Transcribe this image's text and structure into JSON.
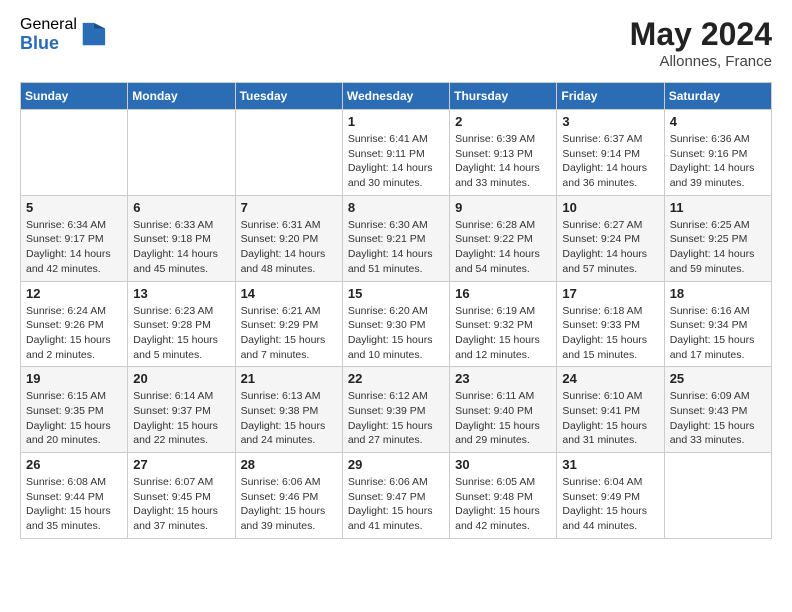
{
  "header": {
    "logo_general": "General",
    "logo_blue": "Blue",
    "month_year": "May 2024",
    "location": "Allonnes, France"
  },
  "days_of_week": [
    "Sunday",
    "Monday",
    "Tuesday",
    "Wednesday",
    "Thursday",
    "Friday",
    "Saturday"
  ],
  "weeks": [
    [
      {
        "day": "",
        "info": ""
      },
      {
        "day": "",
        "info": ""
      },
      {
        "day": "",
        "info": ""
      },
      {
        "day": "1",
        "info": "Sunrise: 6:41 AM\nSunset: 9:11 PM\nDaylight: 14 hours and 30 minutes."
      },
      {
        "day": "2",
        "info": "Sunrise: 6:39 AM\nSunset: 9:13 PM\nDaylight: 14 hours and 33 minutes."
      },
      {
        "day": "3",
        "info": "Sunrise: 6:37 AM\nSunset: 9:14 PM\nDaylight: 14 hours and 36 minutes."
      },
      {
        "day": "4",
        "info": "Sunrise: 6:36 AM\nSunset: 9:16 PM\nDaylight: 14 hours and 39 minutes."
      }
    ],
    [
      {
        "day": "5",
        "info": "Sunrise: 6:34 AM\nSunset: 9:17 PM\nDaylight: 14 hours and 42 minutes."
      },
      {
        "day": "6",
        "info": "Sunrise: 6:33 AM\nSunset: 9:18 PM\nDaylight: 14 hours and 45 minutes."
      },
      {
        "day": "7",
        "info": "Sunrise: 6:31 AM\nSunset: 9:20 PM\nDaylight: 14 hours and 48 minutes."
      },
      {
        "day": "8",
        "info": "Sunrise: 6:30 AM\nSunset: 9:21 PM\nDaylight: 14 hours and 51 minutes."
      },
      {
        "day": "9",
        "info": "Sunrise: 6:28 AM\nSunset: 9:22 PM\nDaylight: 14 hours and 54 minutes."
      },
      {
        "day": "10",
        "info": "Sunrise: 6:27 AM\nSunset: 9:24 PM\nDaylight: 14 hours and 57 minutes."
      },
      {
        "day": "11",
        "info": "Sunrise: 6:25 AM\nSunset: 9:25 PM\nDaylight: 14 hours and 59 minutes."
      }
    ],
    [
      {
        "day": "12",
        "info": "Sunrise: 6:24 AM\nSunset: 9:26 PM\nDaylight: 15 hours and 2 minutes."
      },
      {
        "day": "13",
        "info": "Sunrise: 6:23 AM\nSunset: 9:28 PM\nDaylight: 15 hours and 5 minutes."
      },
      {
        "day": "14",
        "info": "Sunrise: 6:21 AM\nSunset: 9:29 PM\nDaylight: 15 hours and 7 minutes."
      },
      {
        "day": "15",
        "info": "Sunrise: 6:20 AM\nSunset: 9:30 PM\nDaylight: 15 hours and 10 minutes."
      },
      {
        "day": "16",
        "info": "Sunrise: 6:19 AM\nSunset: 9:32 PM\nDaylight: 15 hours and 12 minutes."
      },
      {
        "day": "17",
        "info": "Sunrise: 6:18 AM\nSunset: 9:33 PM\nDaylight: 15 hours and 15 minutes."
      },
      {
        "day": "18",
        "info": "Sunrise: 6:16 AM\nSunset: 9:34 PM\nDaylight: 15 hours and 17 minutes."
      }
    ],
    [
      {
        "day": "19",
        "info": "Sunrise: 6:15 AM\nSunset: 9:35 PM\nDaylight: 15 hours and 20 minutes."
      },
      {
        "day": "20",
        "info": "Sunrise: 6:14 AM\nSunset: 9:37 PM\nDaylight: 15 hours and 22 minutes."
      },
      {
        "day": "21",
        "info": "Sunrise: 6:13 AM\nSunset: 9:38 PM\nDaylight: 15 hours and 24 minutes."
      },
      {
        "day": "22",
        "info": "Sunrise: 6:12 AM\nSunset: 9:39 PM\nDaylight: 15 hours and 27 minutes."
      },
      {
        "day": "23",
        "info": "Sunrise: 6:11 AM\nSunset: 9:40 PM\nDaylight: 15 hours and 29 minutes."
      },
      {
        "day": "24",
        "info": "Sunrise: 6:10 AM\nSunset: 9:41 PM\nDaylight: 15 hours and 31 minutes."
      },
      {
        "day": "25",
        "info": "Sunrise: 6:09 AM\nSunset: 9:43 PM\nDaylight: 15 hours and 33 minutes."
      }
    ],
    [
      {
        "day": "26",
        "info": "Sunrise: 6:08 AM\nSunset: 9:44 PM\nDaylight: 15 hours and 35 minutes."
      },
      {
        "day": "27",
        "info": "Sunrise: 6:07 AM\nSunset: 9:45 PM\nDaylight: 15 hours and 37 minutes."
      },
      {
        "day": "28",
        "info": "Sunrise: 6:06 AM\nSunset: 9:46 PM\nDaylight: 15 hours and 39 minutes."
      },
      {
        "day": "29",
        "info": "Sunrise: 6:06 AM\nSunset: 9:47 PM\nDaylight: 15 hours and 41 minutes."
      },
      {
        "day": "30",
        "info": "Sunrise: 6:05 AM\nSunset: 9:48 PM\nDaylight: 15 hours and 42 minutes."
      },
      {
        "day": "31",
        "info": "Sunrise: 6:04 AM\nSunset: 9:49 PM\nDaylight: 15 hours and 44 minutes."
      },
      {
        "day": "",
        "info": ""
      }
    ]
  ]
}
